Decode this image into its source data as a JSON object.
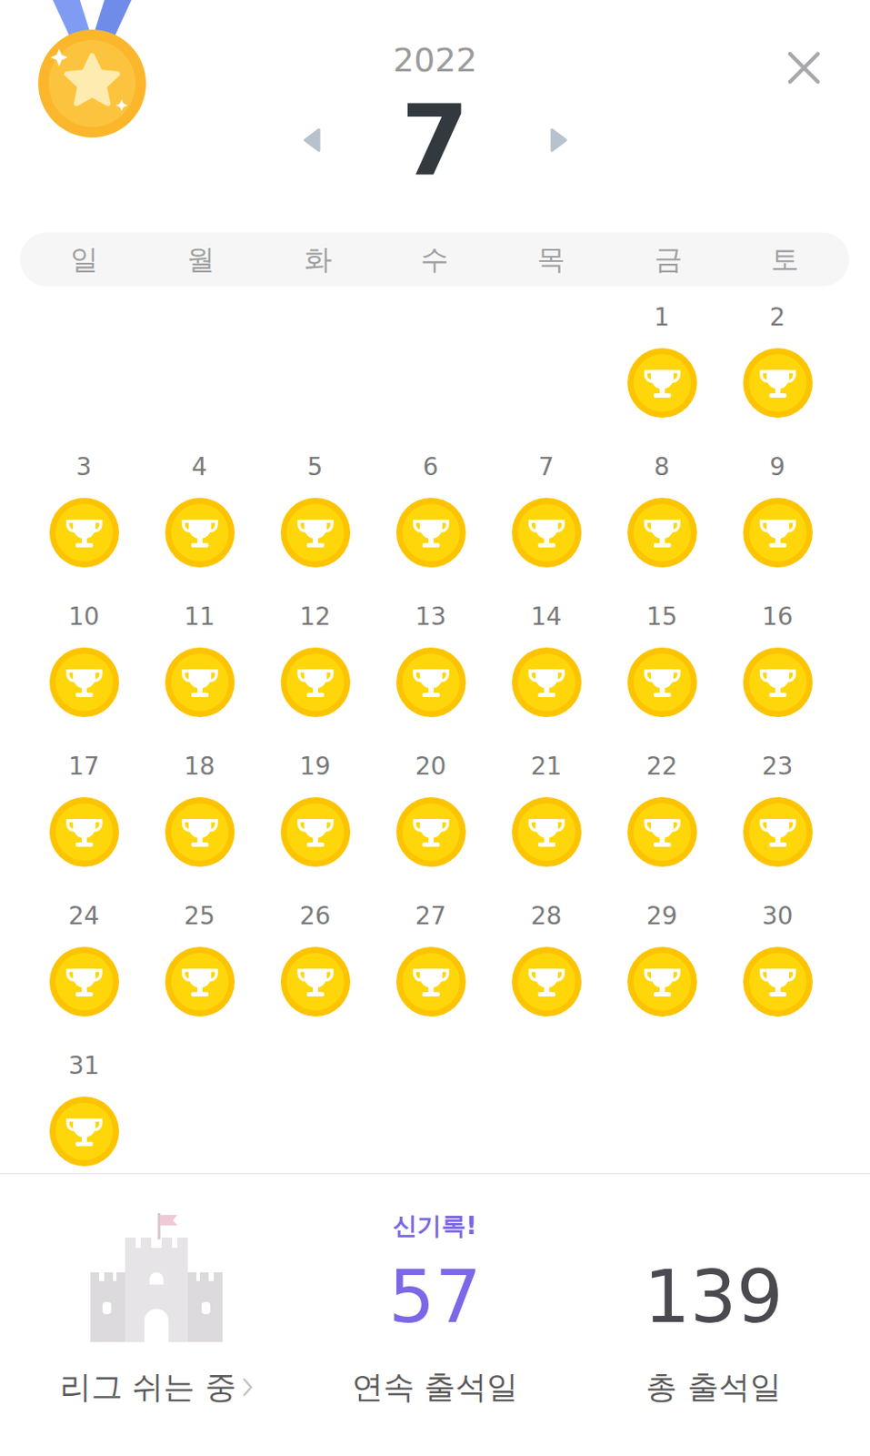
{
  "calendar": {
    "year": "2022",
    "month": "7",
    "weekdays": [
      "일",
      "월",
      "화",
      "수",
      "목",
      "금",
      "토"
    ],
    "days": [
      {
        "day": "1",
        "attended": true
      },
      {
        "day": "2",
        "attended": true
      },
      {
        "day": "3",
        "attended": true
      },
      {
        "day": "4",
        "attended": true
      },
      {
        "day": "5",
        "attended": true
      },
      {
        "day": "6",
        "attended": true
      },
      {
        "day": "7",
        "attended": true
      },
      {
        "day": "8",
        "attended": true
      },
      {
        "day": "9",
        "attended": true
      },
      {
        "day": "10",
        "attended": true
      },
      {
        "day": "11",
        "attended": true
      },
      {
        "day": "12",
        "attended": true
      },
      {
        "day": "13",
        "attended": true
      },
      {
        "day": "14",
        "attended": true
      },
      {
        "day": "15",
        "attended": true
      },
      {
        "day": "16",
        "attended": true
      },
      {
        "day": "17",
        "attended": true
      },
      {
        "day": "18",
        "attended": true
      },
      {
        "day": "19",
        "attended": true
      },
      {
        "day": "20",
        "attended": true
      },
      {
        "day": "21",
        "attended": true
      },
      {
        "day": "22",
        "attended": true
      },
      {
        "day": "23",
        "attended": true
      },
      {
        "day": "24",
        "attended": true
      },
      {
        "day": "25",
        "attended": true
      },
      {
        "day": "26",
        "attended": true
      },
      {
        "day": "27",
        "attended": true
      },
      {
        "day": "28",
        "attended": true
      },
      {
        "day": "29",
        "attended": true
      },
      {
        "day": "30",
        "attended": true
      },
      {
        "day": "31",
        "attended": true
      }
    ]
  },
  "stats": {
    "league": {
      "label": "리그 쉬는 중"
    },
    "streak": {
      "badge": "신기록!",
      "value": "57",
      "label": "연속 출석일"
    },
    "total": {
      "value": "139",
      "label": "총 출석일"
    }
  }
}
